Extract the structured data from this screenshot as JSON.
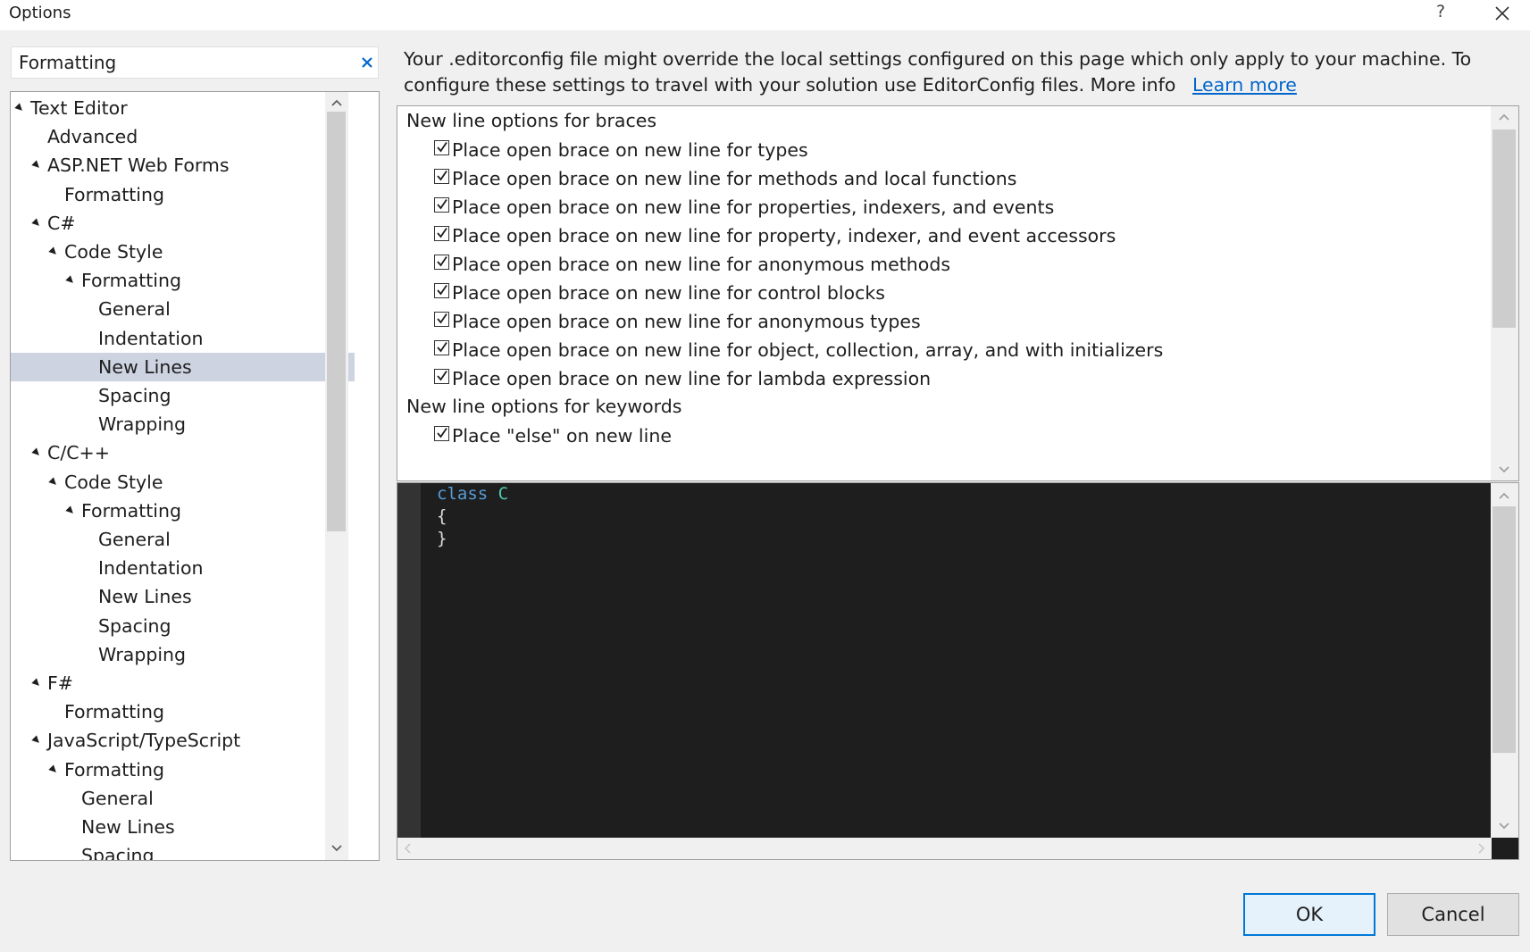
{
  "window": {
    "title": "Options",
    "help_label": "?",
    "icons": {
      "close": "close-icon",
      "help": "help-icon"
    }
  },
  "search": {
    "value": "Formatting",
    "clear_icon": "clear-x-icon"
  },
  "tree": {
    "items": [
      {
        "label": "Text Editor",
        "level": 0,
        "expanded": true
      },
      {
        "label": "Advanced",
        "level": 1
      },
      {
        "label": "ASP.NET Web Forms",
        "level": 1,
        "expanded": true
      },
      {
        "label": "Formatting",
        "level": 2
      },
      {
        "label": "C#",
        "level": 1,
        "expanded": true
      },
      {
        "label": "Code Style",
        "level": 2,
        "expanded": true
      },
      {
        "label": "Formatting",
        "level": 3,
        "expanded": true
      },
      {
        "label": "General",
        "level": 4
      },
      {
        "label": "Indentation",
        "level": 4
      },
      {
        "label": "New Lines",
        "level": 4,
        "selected": true
      },
      {
        "label": "Spacing",
        "level": 4
      },
      {
        "label": "Wrapping",
        "level": 4
      },
      {
        "label": "C/C++",
        "level": 1,
        "expanded": true
      },
      {
        "label": "Code Style",
        "level": 2,
        "expanded": true
      },
      {
        "label": "Formatting",
        "level": 3,
        "expanded": true
      },
      {
        "label": "General",
        "level": 4
      },
      {
        "label": "Indentation",
        "level": 4
      },
      {
        "label": "New Lines",
        "level": 4
      },
      {
        "label": "Spacing",
        "level": 4
      },
      {
        "label": "Wrapping",
        "level": 4
      },
      {
        "label": "F#",
        "level": 1,
        "expanded": true
      },
      {
        "label": "Formatting",
        "level": 2
      },
      {
        "label": "JavaScript/TypeScript",
        "level": 1,
        "expanded": true
      },
      {
        "label": "Formatting",
        "level": 2,
        "expanded": true
      },
      {
        "label": "General",
        "level": 3
      },
      {
        "label": "New Lines",
        "level": 3
      },
      {
        "label": "Spacing",
        "level": 3
      }
    ]
  },
  "info": {
    "text": "Your .editorconfig file might override the local settings configured on this page which only apply to your machine. To configure these settings to travel with your solution use EditorConfig files. More info",
    "link": "Learn more"
  },
  "options": {
    "braces_header": "New line options for braces",
    "braces": [
      {
        "label": "Place open brace on new line for types",
        "checked": true
      },
      {
        "label": "Place open brace on new line for methods and local functions",
        "checked": true
      },
      {
        "label": "Place open brace on new line for properties, indexers, and events",
        "checked": true
      },
      {
        "label": "Place open brace on new line for property, indexer, and event accessors",
        "checked": true
      },
      {
        "label": "Place open brace on new line for anonymous methods",
        "checked": true
      },
      {
        "label": "Place open brace on new line for control blocks",
        "checked": true
      },
      {
        "label": "Place open brace on new line for anonymous types",
        "checked": true
      },
      {
        "label": "Place open brace on new line for object, collection, array, and with initializers",
        "checked": true
      },
      {
        "label": "Place open brace on new line for lambda expression",
        "checked": true
      }
    ],
    "keywords_header": "New line options for keywords",
    "keywords": [
      {
        "label": "Place \"else\" on new line",
        "checked": true
      }
    ]
  },
  "preview": {
    "keyword": "class",
    "class_name": "C",
    "open_brace": "{",
    "close_brace": "}",
    "colors": {
      "background": "#1e1e1e",
      "keyword": "#569cd6",
      "class": "#4ec9b0"
    }
  },
  "buttons": {
    "ok": "OK",
    "cancel": "Cancel"
  },
  "colors": {
    "selection": "#cdd3e1",
    "accent": "#0078d7",
    "link": "#0066cc"
  }
}
